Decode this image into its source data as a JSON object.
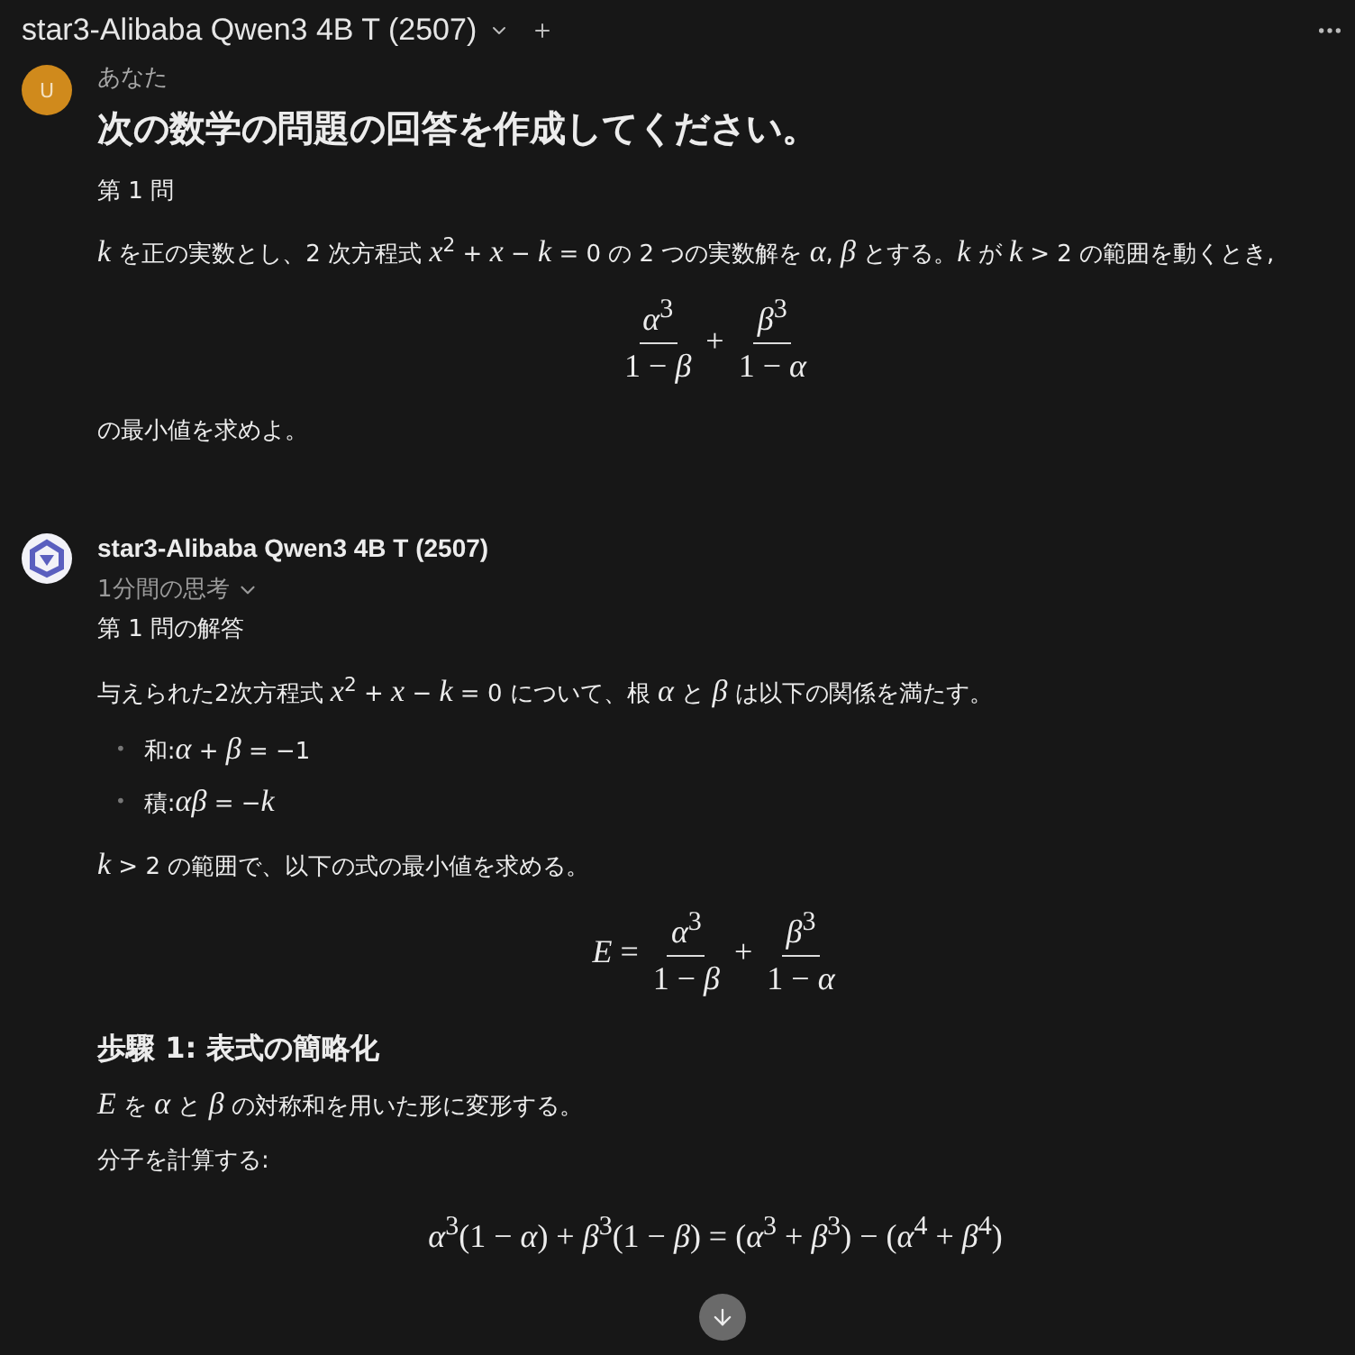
{
  "header": {
    "title": "star3-Alibaba Qwen3 4B T (2507)"
  },
  "messages": [
    {
      "kind": "user",
      "avatar_letter": "U",
      "author": "あなた",
      "blocks": [
        {
          "kind": "heading",
          "text": "次の数学の問題の回答を作成してください。"
        },
        {
          "kind": "para",
          "text": "第 1 問"
        },
        {
          "kind": "para",
          "text": "*k* を正の実数とし、2 次方程式 *x*$^{2}$ + *x* − *k* = 0 の 2 つの実数解を *α*, *β* とする。*k* が *k* > 2 の範囲を動くとき,"
        },
        {
          "kind": "fraction",
          "terms": [
            {
              "num": "*α*$^{3}$",
              "den": "1 − *β*"
            },
            {
              "num": "*β*$^{3}$",
              "den": "1 − *α*"
            }
          ],
          "op": "+"
        },
        {
          "kind": "para",
          "text": "の最小値を求めよ。"
        }
      ]
    },
    {
      "kind": "assistant",
      "author": "star3-Alibaba Qwen3 4B T (2507)",
      "thinking": "1分間の思考",
      "blocks": [
        {
          "kind": "para",
          "text": "第 1 問の解答"
        },
        {
          "kind": "para",
          "text": "与えられた2次方程式 *x*$^{2}$ + *x* − *k* = 0 について、根 *α* と *β* は以下の関係を満たす。"
        },
        {
          "kind": "list",
          "marker": "•",
          "items": [
            "和:*α* + *β* = −1",
            "積:*αβ* = −*k*"
          ]
        },
        {
          "kind": "para",
          "text": "*k* > 2 の範囲で、以下の式の最小値を求める。"
        },
        {
          "kind": "fraction",
          "lhs": "*E* =",
          "terms": [
            {
              "num": "*α*$^{3}$",
              "den": "1 − *β*"
            },
            {
              "num": "*β*$^{3}$",
              "den": "1 − *α*"
            }
          ],
          "op": "+"
        },
        {
          "kind": "subheading",
          "text": "歩驟 1: 表式の簡略化"
        },
        {
          "kind": "para",
          "text": "*E* を *α* と *β* の対称和を用いた形に変形する。"
        },
        {
          "kind": "para",
          "text": "分子を計算する:"
        },
        {
          "kind": "math",
          "text": "*α*$^{3}$(1 − *α*) + *β*$^{3}$(1 − *β*) = (*α*$^{3}$ + *β*$^{3}$) − (*α*$^{4}$ + *β*$^{4}$)"
        }
      ]
    }
  ]
}
